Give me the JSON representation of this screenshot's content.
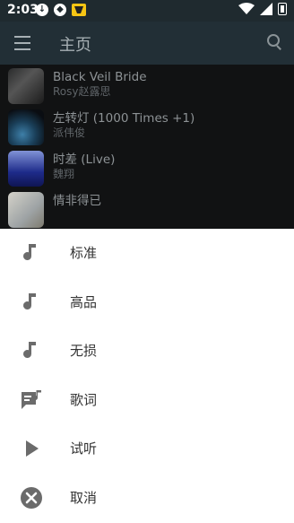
{
  "status_bar": {
    "time": "2:03"
  },
  "app_bar": {
    "title": "主页"
  },
  "songs": [
    {
      "title": "Black Veil Bride",
      "artist": "Rosy赵露思"
    },
    {
      "title": "左转灯 (1000 Times +1)",
      "artist": "派伟俊"
    },
    {
      "title": "时差 (Live)",
      "artist": "魏翔"
    },
    {
      "title": "情非得已",
      "artist": ""
    }
  ],
  "sheet": {
    "items": [
      {
        "label": "标准",
        "icon": "music-note-icon"
      },
      {
        "label": "高品",
        "icon": "music-note-icon"
      },
      {
        "label": "无损",
        "icon": "music-note-icon"
      },
      {
        "label": "歌词",
        "icon": "lyrics-icon"
      },
      {
        "label": "试听",
        "icon": "play-icon"
      },
      {
        "label": "取消",
        "icon": "cancel-icon"
      }
    ]
  },
  "colors": {
    "sheet_bg": "#ffffff",
    "icon": "#666666",
    "appbar": "#222f36"
  }
}
